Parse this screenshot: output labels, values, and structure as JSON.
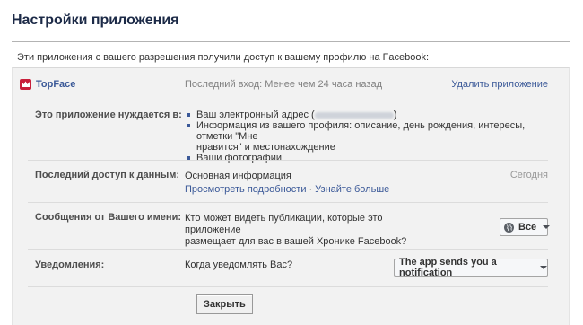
{
  "page": {
    "title": "Настройки приложения",
    "intro": "Эти приложения с вашего разрешения получили доступ к вашему профилю на Facebook:"
  },
  "app": {
    "name": "TopFace",
    "last_login": "Последний вход: Менее чем 24 часа назад",
    "remove_label": "Удалить приложение",
    "logo_color": "#c81f3b"
  },
  "permissions": {
    "label": "Это приложение нуждается в:",
    "items": [
      "Ваш электронный адрес (",
      "Информация из вашего профиля: описание, день рождения, интересы, отметки \"Мне",
      "нравится\" и местонахождение",
      "Ваши фотографии"
    ],
    "email_suffix": ")"
  },
  "last_access": {
    "label": "Последний доступ к данным:",
    "value": "Основная информация",
    "details_link": "Просмотреть подробности",
    "learn_more_link": "Узнайте больше",
    "when": "Сегодня"
  },
  "posts": {
    "label": "Сообщения от Вашего имени:",
    "question_line1": "Кто может видеть публикации, которые это приложение",
    "question_line2": "размещает для вас в вашей Хронике Facebook?",
    "audience": "Все"
  },
  "notifications": {
    "label": "Уведомления:",
    "question": "Когда уведомлять Вас?",
    "value": "The app sends you a notification"
  },
  "close_label": "Закрыть",
  "colors": {
    "link": "#3b5998",
    "title": "#1c2a47",
    "panel": "#f2f2f2"
  }
}
